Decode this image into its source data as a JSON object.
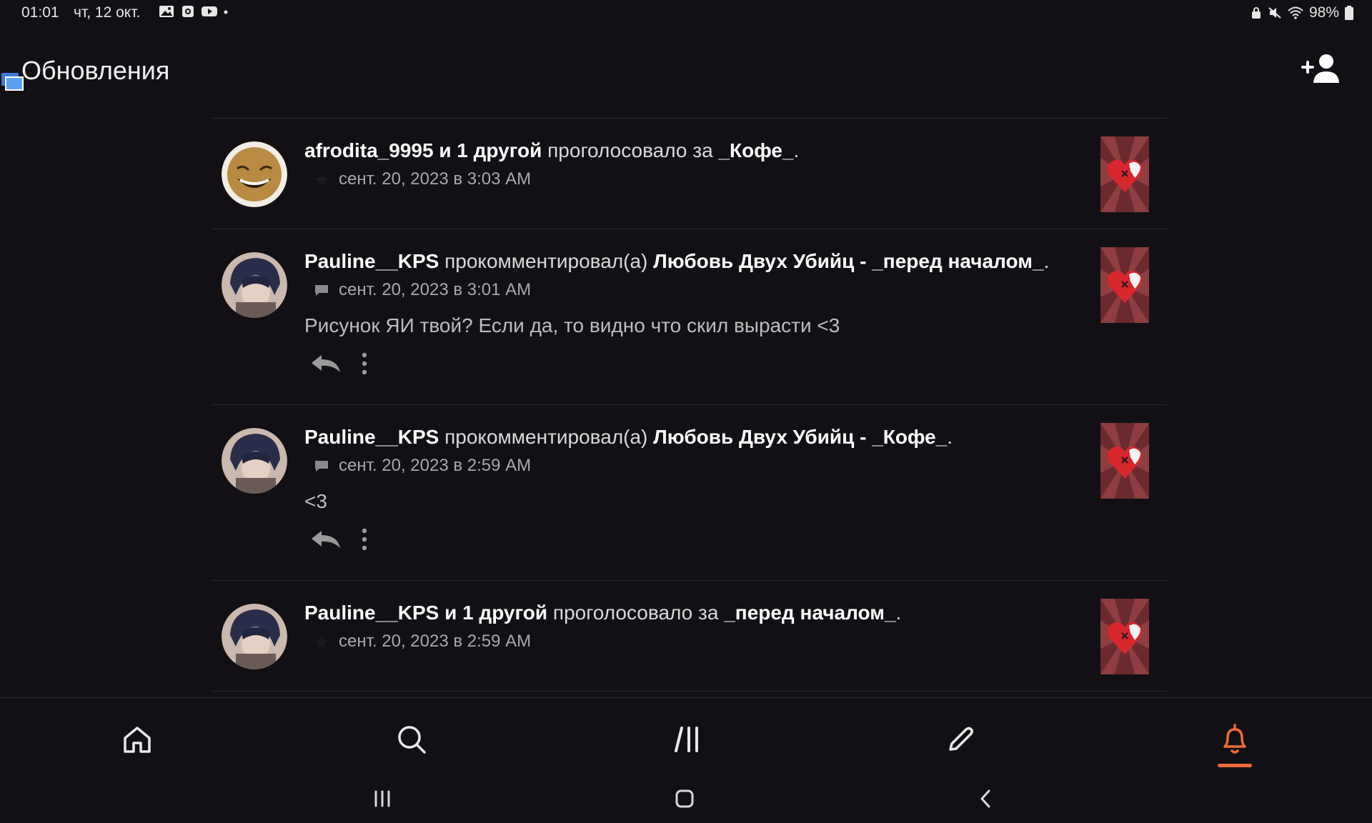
{
  "status_bar": {
    "time": "01:01",
    "date": "чт, 12 окт.",
    "battery": "98%",
    "left_icons": [
      "gallery-icon",
      "camera-icon",
      "youtube-icon",
      "dot-icon"
    ],
    "right_icons": [
      "lock-icon",
      "mute-icon",
      "wifi-icon",
      "battery-icon"
    ]
  },
  "header": {
    "title": "Обновления",
    "add_user_icon": "add-user-icon"
  },
  "colors": {
    "background": "#121014",
    "accent": "#ef6b3a",
    "divider": "#2a282c",
    "text_primary": "#ffffff",
    "text_secondary": "#a9a9a9"
  },
  "feed": {
    "items": [
      {
        "type": "vote",
        "actor": "afrodita_9995 и 1 другой",
        "action": " проголосовало за ",
        "target": "_Кофе_",
        "end": ".",
        "timestamp": "сент. 20, 2023 в 3:03 AM",
        "avatar": "laughing-face-avatar"
      },
      {
        "type": "comment",
        "actor": "Pauline__KPS",
        "action": " прокомментировал(а) ",
        "target": "Любовь Двух Убийц - _перед началом_",
        "end": ".",
        "timestamp": "сент. 20, 2023 в 3:01 AM",
        "comment": "Рисунок ЯИ твой? Если да, то видно что скил вырасти <3",
        "avatar": "anime-girl-avatar"
      },
      {
        "type": "comment",
        "actor": "Pauline__KPS",
        "action": " прокомментировал(а) ",
        "target": "Любовь Двух Убийц - _Кофе_",
        "end": ".",
        "timestamp": "сент. 20, 2023 в 2:59 AM",
        "comment": "<3",
        "avatar": "anime-girl-avatar"
      },
      {
        "type": "vote",
        "actor": "Pauline__KPS и 1 другой",
        "action": " проголосовало за ",
        "target": "_перед началом_",
        "end": ".",
        "timestamp": "сент. 20, 2023 в 2:59 AM",
        "avatar": "anime-girl-avatar"
      }
    ]
  },
  "bottom_nav": {
    "items": [
      "home-icon",
      "search-icon",
      "library-icon",
      "write-icon",
      "notifications-icon"
    ],
    "active": "notifications-icon"
  },
  "system_nav": {
    "items": [
      "recent-apps-icon",
      "home-circle-icon",
      "back-icon"
    ]
  }
}
